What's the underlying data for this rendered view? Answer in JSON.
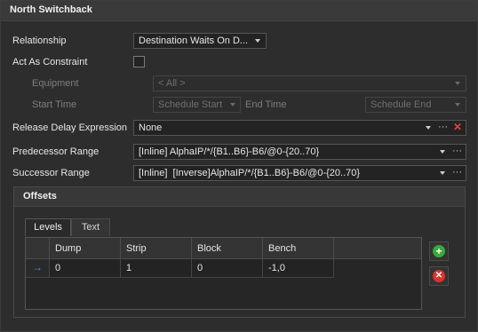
{
  "window": {
    "title": "North Switchback"
  },
  "fields": {
    "relationship": {
      "label": "Relationship",
      "value": "Destination Waits On D..."
    },
    "act_as_constraint": {
      "label": "Act As Constraint",
      "checked": false
    },
    "equipment": {
      "label": "Equipment",
      "value": "< All >"
    },
    "start_time": {
      "label": "Start Time",
      "value": "Schedule Start"
    },
    "end_time": {
      "label": "End Time",
      "value": "Schedule End"
    },
    "release_delay": {
      "label": "Release Delay Expression",
      "value": "None"
    },
    "predecessor_range": {
      "label": "Predecessor Range",
      "value": "[Inline] AlphaIP/*/{B1..B6}-B6/@0-{20..70}"
    },
    "successor_range": {
      "label": "Successor Range",
      "value": "[Inline]  [Inverse]AlphaIP/*/{B1..B6}-B6/@0-{20..70}"
    }
  },
  "ellipsis": "···",
  "clear_glyph": "✕",
  "offsets": {
    "title": "Offsets",
    "tabs": [
      "Levels",
      "Text"
    ],
    "active_tab": "Levels",
    "columns": [
      "Dump",
      "Strip",
      "Block",
      "Bench"
    ],
    "rows": [
      [
        "0",
        "1",
        "0",
        "-1,0"
      ]
    ],
    "row_indicator": "→",
    "add_glyph": "+",
    "remove_glyph": "✕"
  },
  "colors": {
    "accent_add": "#3aa83a",
    "accent_remove": "#d9342b"
  },
  "icons": [
    "dropdown-arrow-icon",
    "ellipsis-icon",
    "clear-icon",
    "add-icon",
    "remove-icon",
    "row-indicator-icon"
  ]
}
